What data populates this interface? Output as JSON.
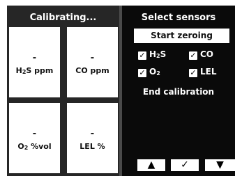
{
  "left_panel": {
    "title": "Calibrating...",
    "tiles": [
      {
        "value": "-",
        "unit_main": "H",
        "unit_sub": "2",
        "unit_rest": "S ppm"
      },
      {
        "value": "-",
        "unit_main": "CO ppm",
        "unit_sub": "",
        "unit_rest": ""
      },
      {
        "value": "-",
        "unit_main": "O",
        "unit_sub": "2",
        "unit_rest": " %vol"
      },
      {
        "value": "-",
        "unit_main": "LEL %",
        "unit_sub": "",
        "unit_rest": ""
      }
    ]
  },
  "right_panel": {
    "title": "Select sensors",
    "start_zeroing_label": "Start zeroing",
    "sensors": [
      {
        "main": "H",
        "sub": "2",
        "rest": "S",
        "checked": true
      },
      {
        "main": "CO",
        "sub": "",
        "rest": "",
        "checked": true
      },
      {
        "main": "O",
        "sub": "2",
        "rest": "",
        "checked": true
      },
      {
        "main": "LEL",
        "sub": "",
        "rest": "",
        "checked": true
      }
    ],
    "end_calibration_label": "End calibration",
    "nav": {
      "up_icon": "▲",
      "confirm_icon": "✓",
      "down_icon": "▼"
    }
  },
  "colors": {
    "left_panel_bg": "#262626",
    "right_panel_bg": "#0a0a0a",
    "tile_bg": "#ffffff",
    "text_light": "#ffffff"
  }
}
